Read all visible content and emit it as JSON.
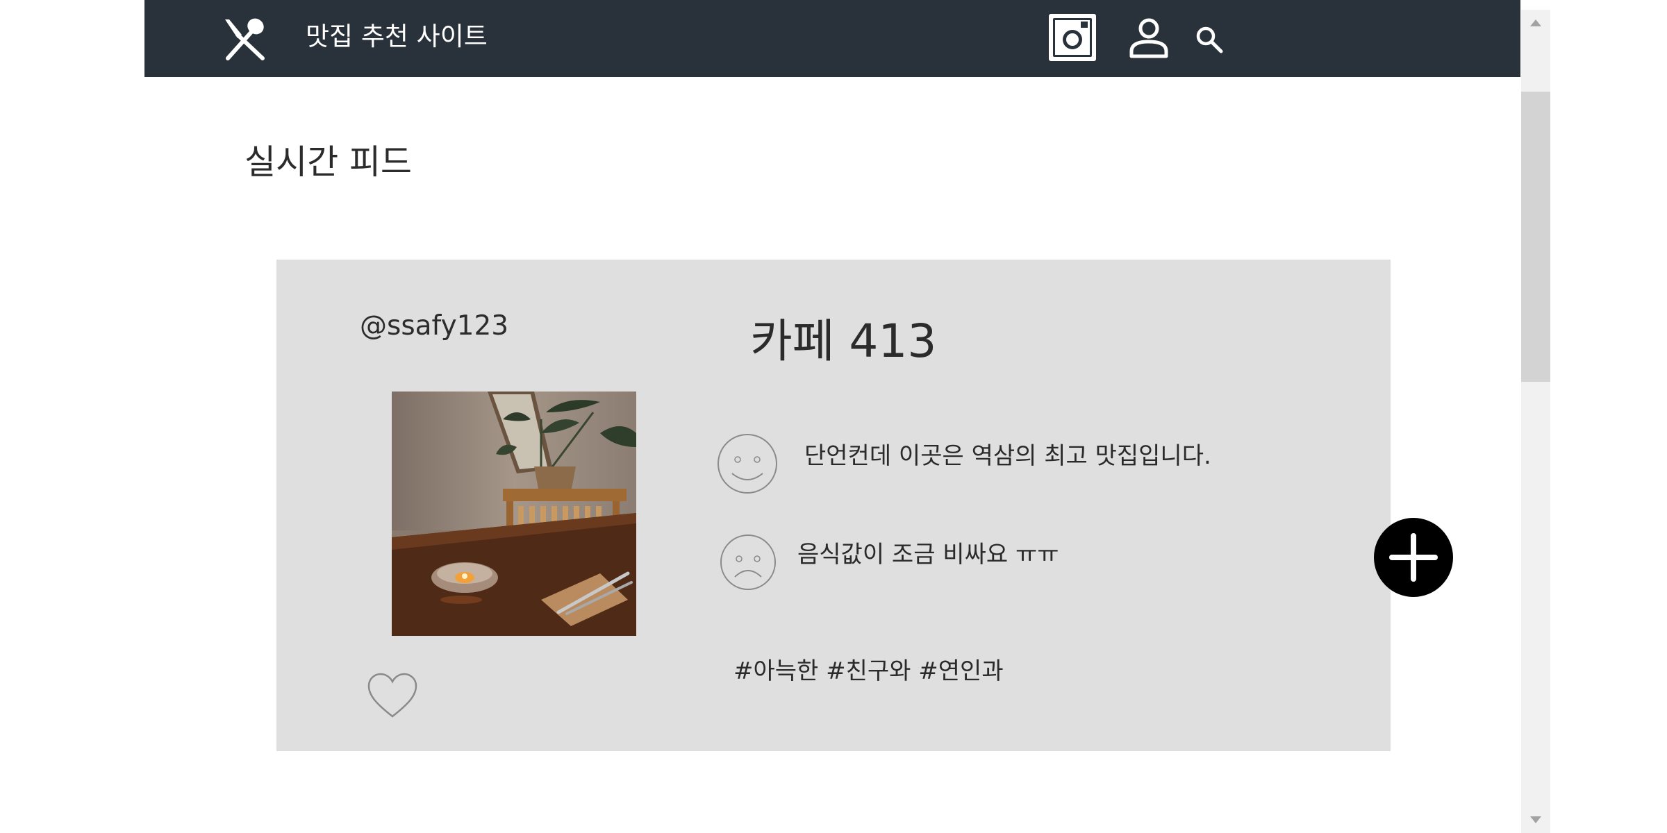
{
  "header": {
    "site_title": "맛집 추천 사이트",
    "background_color": "#29323a",
    "icons": [
      "fork-spoon-icon",
      "instagram-icon",
      "user-icon",
      "search-icon"
    ]
  },
  "feed": {
    "title": "실시간 피드"
  },
  "post": {
    "username": "@ssafy123",
    "restaurant_name": "카페 413",
    "review_good": "단언컨데 이곳은 역삼의 최고 맛집입니다.",
    "review_bad": "음식값이 조금 비싸요 ㅠㅠ",
    "hashtags": "#아늑한 #친구와 #연인과",
    "photo_subject": "cafe table with candle, cutlery, chair and plant",
    "card_color": "#dfdfdf"
  },
  "actions": {
    "add_button_icon": "plus-icon",
    "add_button_color": "#000000"
  }
}
